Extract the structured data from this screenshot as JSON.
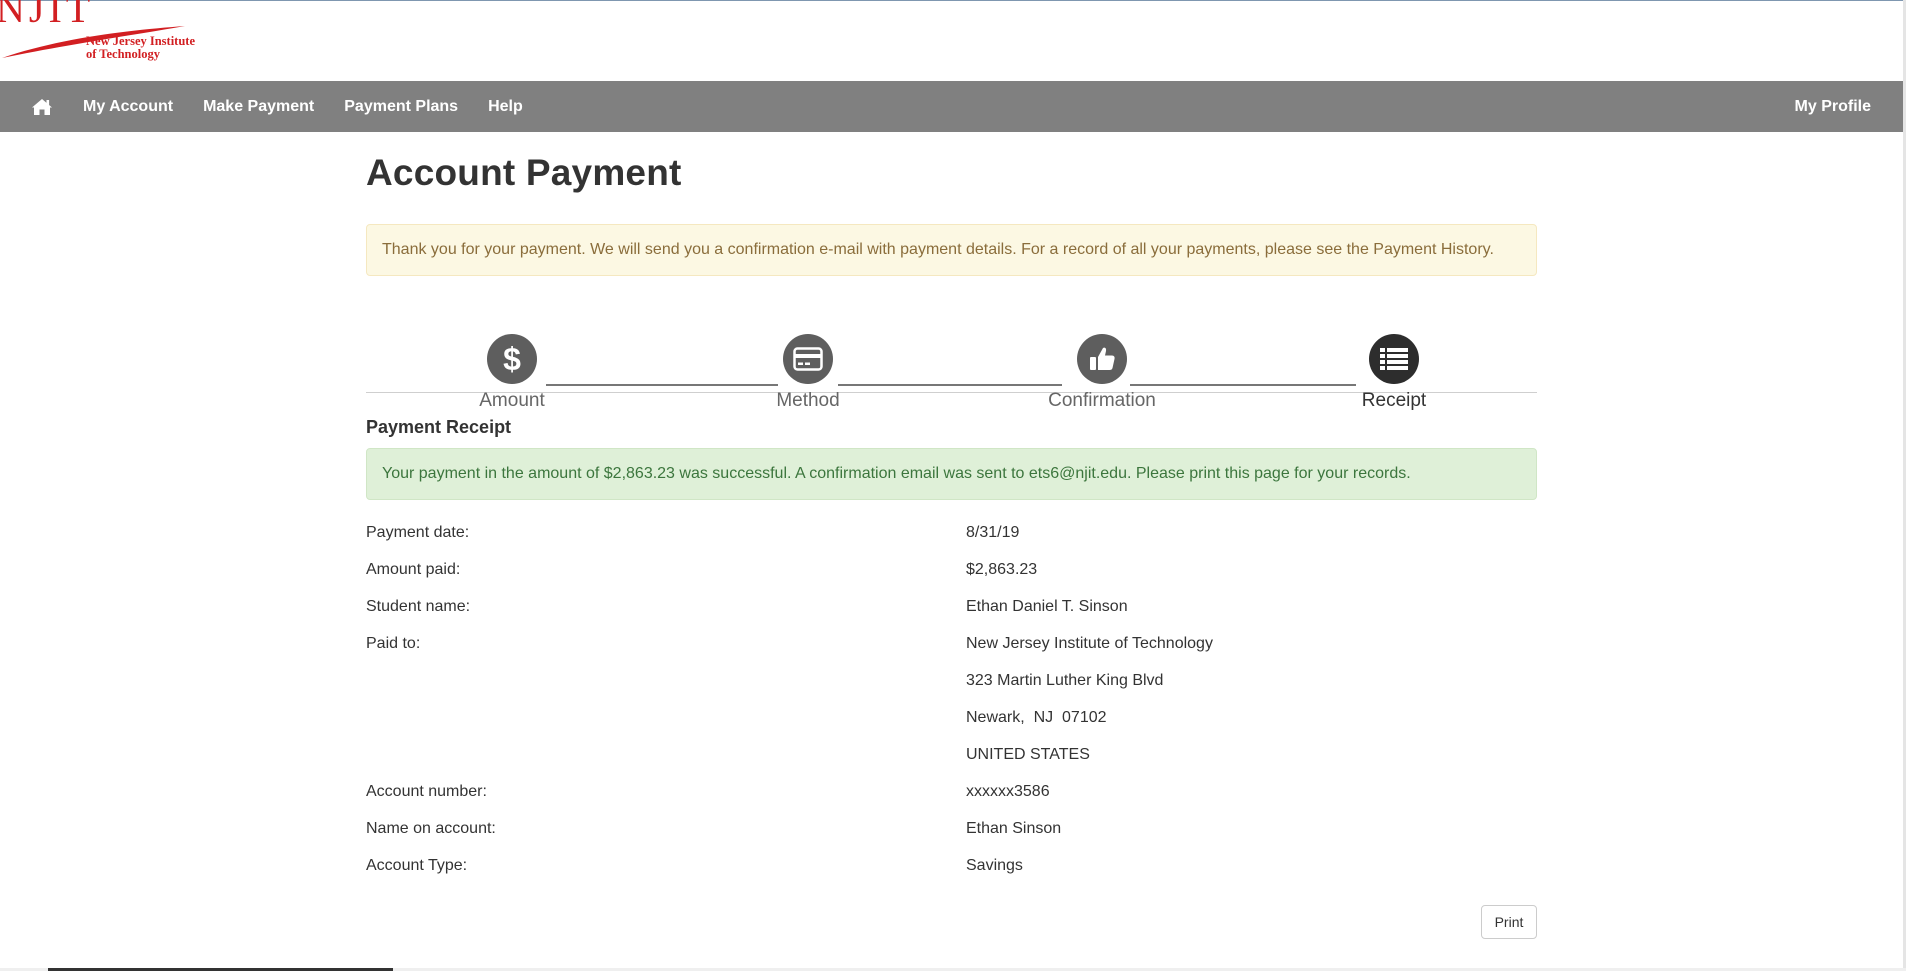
{
  "logo": {
    "wordmark": "NJIT",
    "name_line1": "New Jersey Institute",
    "name_line2": "of Technology",
    "color": "#d21f22"
  },
  "nav": {
    "home_icon": "home-icon",
    "links": [
      "My Account",
      "Make Payment",
      "Payment Plans",
      "Help"
    ],
    "right": "My Profile",
    "background": "#808080"
  },
  "page": {
    "title": "Account Payment",
    "notice": "Thank you for your payment. We will send you a confirmation e-mail with payment details. For a record of all your payments, please see the Payment History."
  },
  "steps": [
    {
      "label": "Amount",
      "icon": "dollar-icon",
      "active": false
    },
    {
      "label": "Method",
      "icon": "credit-card-icon",
      "active": false
    },
    {
      "label": "Confirmation",
      "icon": "thumbs-up-icon",
      "active": false
    },
    {
      "label": "Receipt",
      "icon": "list-icon",
      "active": true
    }
  ],
  "receipt": {
    "title": "Payment Receipt",
    "success_message": "Your payment in the amount of $2,863.23 was successful.  A confirmation email was sent to ets6@njit.edu.  Please print this page for your records.",
    "rows": [
      {
        "label": "Payment date:",
        "value": "8/31/19"
      },
      {
        "label": "Amount paid:",
        "value": "$2,863.23"
      },
      {
        "label": "Student name:",
        "value": "Ethan Daniel T. Sinson"
      },
      {
        "label": "Paid to:",
        "value": "New Jersey Institute of Technology"
      },
      {
        "label": "",
        "value": "323 Martin Luther King Blvd"
      },
      {
        "label": "",
        "value": "Newark,  NJ  07102"
      },
      {
        "label": "",
        "value": "UNITED STATES"
      },
      {
        "label": "Account number:",
        "value": "xxxxxx3586"
      },
      {
        "label": "Name on account:",
        "value": "Ethan Sinson"
      },
      {
        "label": "Account Type:",
        "value": "Savings"
      }
    ],
    "print_label": "Print"
  }
}
